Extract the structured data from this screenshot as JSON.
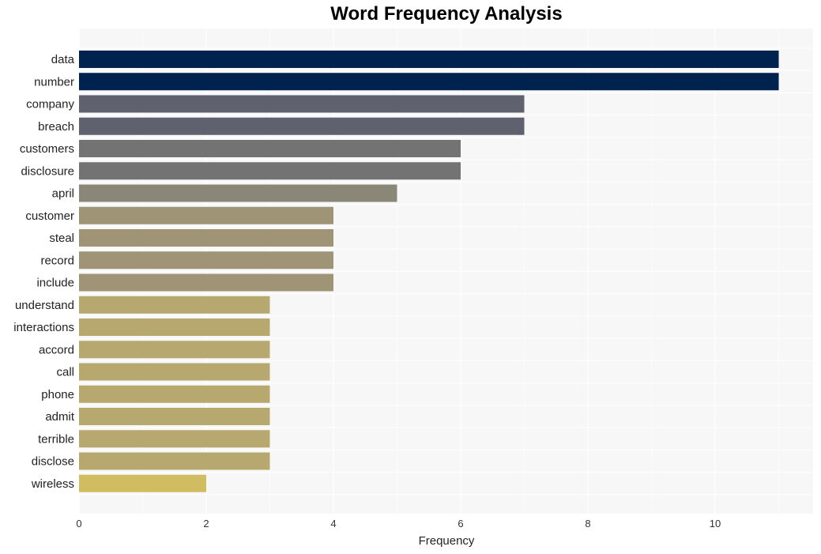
{
  "chart_data": {
    "type": "bar",
    "orientation": "horizontal",
    "title": "Word Frequency Analysis",
    "xlabel": "Frequency",
    "ylabel": "",
    "xlim": [
      0,
      11.54
    ],
    "xticks": [
      0,
      2,
      4,
      6,
      8,
      10
    ],
    "grid": true,
    "categories": [
      "data",
      "number",
      "company",
      "breach",
      "customers",
      "disclosure",
      "april",
      "customer",
      "steal",
      "record",
      "include",
      "understand",
      "interactions",
      "accord",
      "call",
      "phone",
      "admit",
      "terrible",
      "disclose",
      "wireless"
    ],
    "values": [
      11,
      11,
      7,
      7,
      6,
      6,
      5,
      4,
      4,
      4,
      4,
      3,
      3,
      3,
      3,
      3,
      3,
      3,
      3,
      2
    ],
    "colors": [
      "#00224e",
      "#00224e",
      "#5f616e",
      "#5f616e",
      "#737373",
      "#737373",
      "#8a8779",
      "#9f9475",
      "#9f9475",
      "#9f9475",
      "#9f9475",
      "#b7a86f",
      "#b7a86f",
      "#b7a86f",
      "#b7a86f",
      "#b7a86f",
      "#b7a86f",
      "#b7a86f",
      "#b7a86f",
      "#d0bd61"
    ]
  }
}
